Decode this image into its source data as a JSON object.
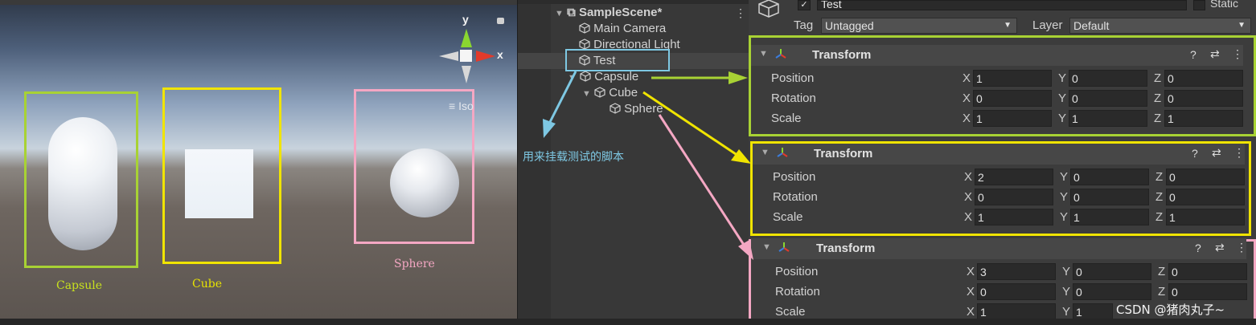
{
  "scene": {
    "gizmo": {
      "y": "y",
      "x": "x",
      "projection": "Iso"
    },
    "labels": {
      "capsule": "Capsule",
      "cube": "Cube",
      "sphere": "Sphere"
    },
    "colors": {
      "capsule": "#a8d234",
      "cube": "#f0e400",
      "sphere": "#f4a7c3",
      "test_box": "#7ec8e3"
    }
  },
  "hierarchy": {
    "scene_name": "SampleScene*",
    "items": [
      "Main Camera",
      "Directional Light",
      "Test",
      "Capsule",
      "Cube",
      "Sphere"
    ],
    "annotation": "用来挂载测试的脚本"
  },
  "inspector": {
    "object_name": "Test",
    "static_label": "Static",
    "tag_label": "Tag",
    "tag_value": "Untagged",
    "layer_label": "Layer",
    "layer_value": "Default",
    "component_title": "Transform",
    "row_labels": [
      "Position",
      "Rotation",
      "Scale"
    ],
    "axes": [
      "X",
      "Y",
      "Z"
    ],
    "transforms": [
      {
        "position": [
          "1",
          "0",
          "0"
        ],
        "rotation": [
          "0",
          "0",
          "0"
        ],
        "scale": [
          "1",
          "1",
          "1"
        ]
      },
      {
        "position": [
          "2",
          "0",
          "0"
        ],
        "rotation": [
          "0",
          "0",
          "0"
        ],
        "scale": [
          "1",
          "1",
          "1"
        ]
      },
      {
        "position": [
          "3",
          "0",
          "0"
        ],
        "rotation": [
          "0",
          "0",
          "0"
        ],
        "scale": [
          "1",
          "1",
          ""
        ]
      }
    ]
  },
  "watermark": "CSDN @猪肉丸子~"
}
